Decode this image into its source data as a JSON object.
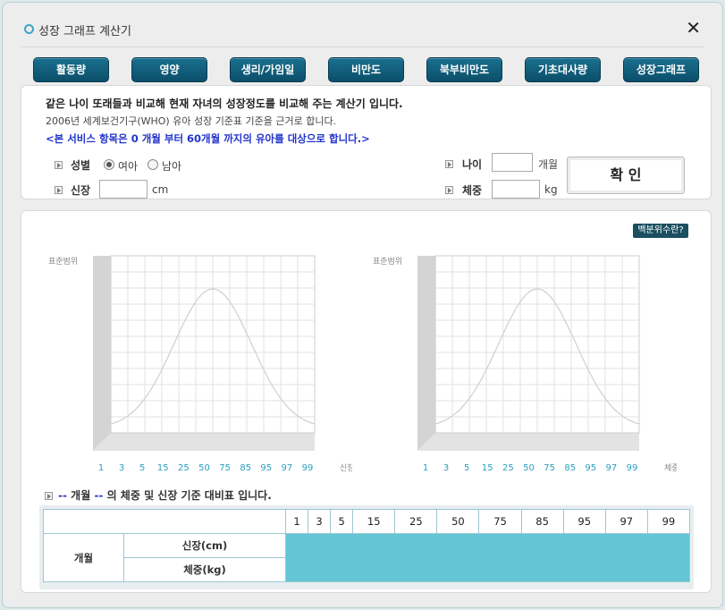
{
  "window": {
    "title": "성장 그래프 계산기"
  },
  "tabs": [
    "활동량",
    "영양",
    "생리/가임일",
    "비만도",
    "북부비만도",
    "기초대사량",
    "성장그래프"
  ],
  "intro": {
    "line1": "같은 나이 또래들과 비교해 현재 자녀의 성장정도를 비교해 주는 계산기 입니다.",
    "line2": "2006년 세계보건기구(WHO) 유아 성장 기준표 기준을 근거로 합니다.",
    "line3": "<본 서비스 항목은 0 개월 부터 60개월 까지의 유아를 대상으로 합니다.>"
  },
  "form": {
    "gender_label": "성별",
    "gender_options": [
      {
        "label": "여아",
        "selected": true
      },
      {
        "label": "남아",
        "selected": false
      }
    ],
    "height_label": "신장",
    "height_value": "",
    "height_unit": "cm",
    "age_label": "나이",
    "age_value": "",
    "age_unit": "개월",
    "weight_label": "체중",
    "weight_value": "",
    "weight_unit": "kg",
    "confirm_label": "확 인"
  },
  "charts": {
    "help_label": "백분위수란?",
    "ylabel": "표준범위",
    "ticks": [
      "1",
      "3",
      "5",
      "15",
      "25",
      "50",
      "75",
      "85",
      "95",
      "97",
      "99"
    ],
    "left": {
      "xlabel": "신장백분위수"
    },
    "right": {
      "xlabel": "체중백분위수"
    }
  },
  "table": {
    "title_prefix": "--",
    "title_mid": "개월",
    "title_dash": "--",
    "title_suffix": "의 체중 및 신장 기준 대비표 입니다.",
    "percentiles": [
      "1",
      "3",
      "5",
      "15",
      "25",
      "50",
      "75",
      "85",
      "95",
      "97",
      "99"
    ],
    "row_group": "개월",
    "row_height": "신장(cm)",
    "row_weight": "체중(kg)"
  },
  "colors": {
    "tab": "#0b4f6a",
    "accent": "#3aa7c4",
    "fill": "#63c6d6",
    "notice": "#2233cc"
  }
}
